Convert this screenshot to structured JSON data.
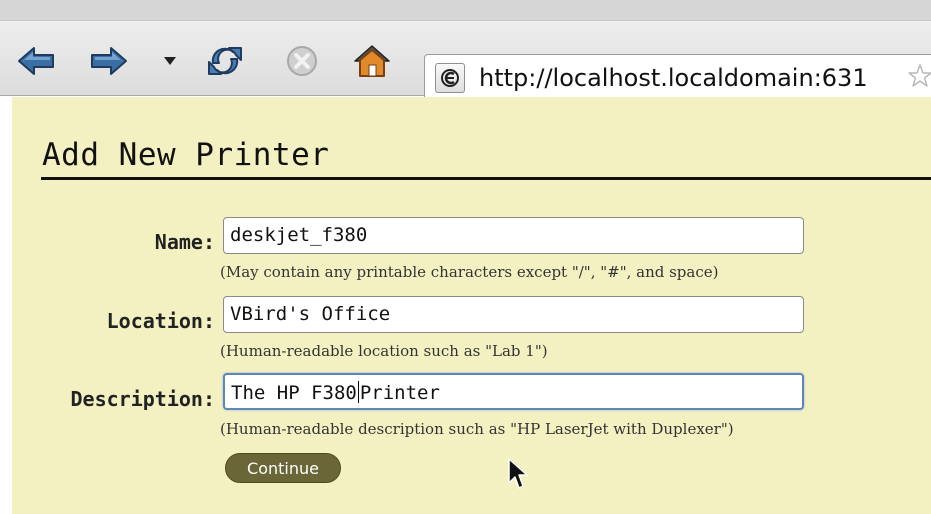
{
  "browser": {
    "url": "http://localhost.localdomain:631",
    "buttons": {
      "back": "back-arrow",
      "forward": "forward-arrow",
      "history": "history-dropdown",
      "reload": "reload",
      "stop": "stop",
      "home": "home"
    }
  },
  "page": {
    "title": "Add New Printer",
    "background": "#f3f1c1",
    "fields": [
      {
        "label": "Name:",
        "value": "deskjet_f380",
        "hint": "(May contain any printable characters except \"/\", \"#\", and space)"
      },
      {
        "label": "Location:",
        "value": "VBird's Office",
        "hint": "(Human-readable location such as \"Lab 1\")"
      },
      {
        "label": "Description:",
        "value_before_caret": "The HP F380",
        "value_after_caret": "Printer",
        "hint": "(Human-readable description such as \"HP LaserJet with Duplexer\")"
      }
    ],
    "continue_label": "Continue"
  },
  "colors": {
    "button": "#6b6637",
    "focus_border": "#5e86b8",
    "arrow_blue": "#3b6ea5"
  }
}
